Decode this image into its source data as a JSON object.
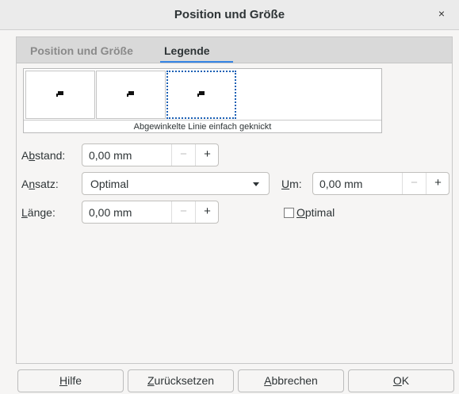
{
  "window": {
    "title": "Position und Größe",
    "close_glyph": "×"
  },
  "tabs": [
    {
      "label": "Position und Größe",
      "active": false
    },
    {
      "label": "Legende",
      "active": true
    }
  ],
  "accent_color": "#3584e4",
  "preview": {
    "caption": "Abgewinkelte Linie einfach geknickt",
    "tiles": [
      {
        "icon": "callout-line-icon",
        "selected": false
      },
      {
        "icon": "callout-line-icon",
        "selected": false
      },
      {
        "icon": "callout-line-icon",
        "selected": true
      }
    ]
  },
  "form": {
    "abstand": {
      "label_pre": "A",
      "label_mn": "b",
      "label_post": "stand:",
      "value": "0,00 mm",
      "minus": "−",
      "plus": "+"
    },
    "ansatz": {
      "label_pre": "A",
      "label_mn": "n",
      "label_post": "satz:",
      "value": "Optimal"
    },
    "um": {
      "label_pre": "",
      "label_mn": "U",
      "label_post": "m:",
      "value": "0,00 mm",
      "minus": "−",
      "plus": "+"
    },
    "laenge": {
      "label_pre": "",
      "label_mn": "L",
      "label_post": "änge:",
      "value": "0,00 mm",
      "minus": "−",
      "plus": "+"
    },
    "optimal_checkbox": {
      "label_pre": "",
      "label_mn": "O",
      "label_post": "ptimal",
      "checked": false
    }
  },
  "buttons": {
    "help": {
      "pre": "",
      "mn": "H",
      "post": "ilfe"
    },
    "reset": {
      "pre": "",
      "mn": "Z",
      "post": "urücksetzen"
    },
    "cancel": {
      "pre": "",
      "mn": "A",
      "post": "bbrechen"
    },
    "ok": {
      "pre": "",
      "mn": "O",
      "post": "K"
    }
  }
}
